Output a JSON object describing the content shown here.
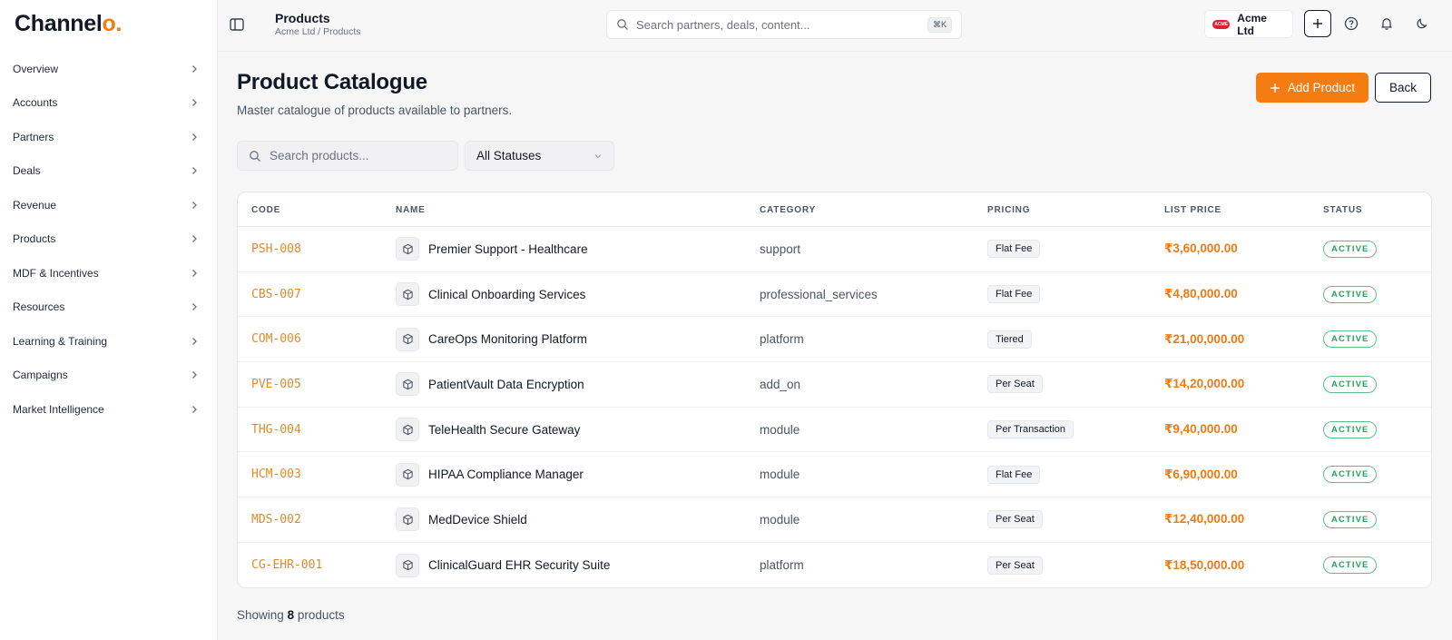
{
  "app": {
    "logo_main": "Channel",
    "logo_accent": "o",
    "logo_dot": "."
  },
  "sidebar": {
    "items": [
      {
        "label": "Overview"
      },
      {
        "label": "Accounts"
      },
      {
        "label": "Partners"
      },
      {
        "label": "Deals"
      },
      {
        "label": "Revenue"
      },
      {
        "label": "Products"
      },
      {
        "label": "MDF & Incentives"
      },
      {
        "label": "Resources"
      },
      {
        "label": "Learning & Training"
      },
      {
        "label": "Campaigns"
      },
      {
        "label": "Market Intelligence"
      }
    ]
  },
  "header": {
    "title": "Products",
    "breadcrumb": "Acme Ltd / Products",
    "search_placeholder": "Search partners, deals, content...",
    "search_shortcut": "⌘K",
    "org_badge": "ACME",
    "org_name": "Acme Ltd"
  },
  "page": {
    "title": "Product Catalogue",
    "subtitle": "Master catalogue of products available to partners.",
    "add_label": "Add Product",
    "back_label": "Back",
    "search_placeholder": "Search products...",
    "status_filter": "All Statuses"
  },
  "table": {
    "columns": {
      "code": "CODE",
      "name": "NAME",
      "category": "CATEGORY",
      "pricing": "PRICING",
      "list_price": "LIST PRICE",
      "status": "STATUS"
    },
    "rows": [
      {
        "code": "PSH-008",
        "name": "Premier Support - Healthcare",
        "category": "support",
        "pricing": "Flat Fee",
        "price": "₹3,60,000.00",
        "status": "ACTIVE"
      },
      {
        "code": "CBS-007",
        "name": "Clinical Onboarding Services",
        "category": "professional_services",
        "pricing": "Flat Fee",
        "price": "₹4,80,000.00",
        "status": "ACTIVE"
      },
      {
        "code": "COM-006",
        "name": "CareOps Monitoring Platform",
        "category": "platform",
        "pricing": "Tiered",
        "price": "₹21,00,000.00",
        "status": "ACTIVE"
      },
      {
        "code": "PVE-005",
        "name": "PatientVault Data Encryption",
        "category": "add_on",
        "pricing": "Per Seat",
        "price": "₹14,20,000.00",
        "status": "ACTIVE"
      },
      {
        "code": "THG-004",
        "name": "TeleHealth Secure Gateway",
        "category": "module",
        "pricing": "Per Transaction",
        "price": "₹9,40,000.00",
        "status": "ACTIVE"
      },
      {
        "code": "HCM-003",
        "name": "HIPAA Compliance Manager",
        "category": "module",
        "pricing": "Flat Fee",
        "price": "₹6,90,000.00",
        "status": "ACTIVE"
      },
      {
        "code": "MDS-002",
        "name": "MedDevice Shield",
        "category": "module",
        "pricing": "Per Seat",
        "price": "₹12,40,000.00",
        "status": "ACTIVE"
      },
      {
        "code": "CG-EHR-001",
        "name": "ClinicalGuard EHR Security Suite",
        "category": "platform",
        "pricing": "Per Seat",
        "price": "₹18,50,000.00",
        "status": "ACTIVE"
      }
    ]
  },
  "footer": {
    "prefix": "Showing",
    "count": "8",
    "suffix": "products"
  },
  "colors": {
    "accent": "#f57c10",
    "active": "#22a35a",
    "code": "#e08a2b"
  }
}
